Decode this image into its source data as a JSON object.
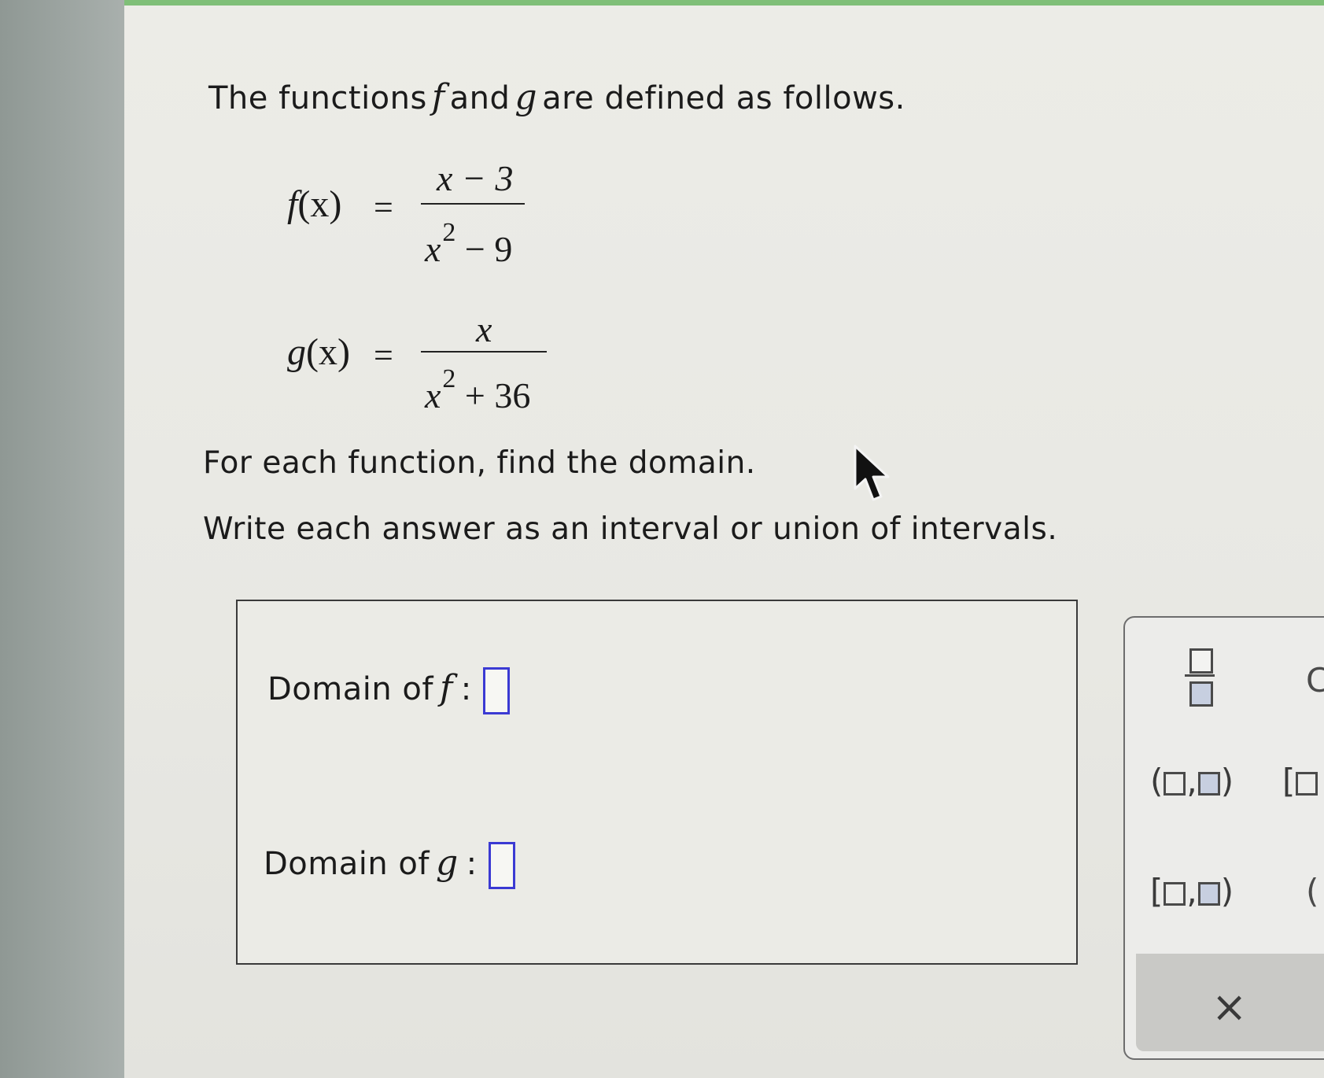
{
  "question": {
    "intro_before": "The functions",
    "f_symbol": "f",
    "and_word": "and",
    "g_symbol": "g",
    "intro_after": "are defined as follows.",
    "f_def": {
      "lhs_name": "f",
      "lhs_arg": "(x)",
      "equals": "=",
      "numerator": "x − 3",
      "den_base": "x",
      "den_exp": "2",
      "den_rest": "− 9"
    },
    "g_def": {
      "lhs_name": "g",
      "lhs_arg": "(x)",
      "equals": "=",
      "numerator": "x",
      "den_base": "x",
      "den_exp": "2",
      "den_rest": "+ 36"
    },
    "instruction_1": "For each function, find the domain.",
    "instruction_2": "Write each answer as an interval or union of intervals."
  },
  "answers": {
    "domain_f_label": "Domain of",
    "f_symbol": "f",
    "colon": ":",
    "domain_f_value": "",
    "domain_g_label": "Domain of",
    "g_symbol": "g",
    "domain_g_value": ""
  },
  "palette": {
    "open_open": {
      "left": "(",
      "comma": ",",
      "right": ")"
    },
    "closed_open": {
      "left": "[",
      "comma": ",",
      "right": ")"
    },
    "partial_bracket": "[",
    "partial_right_top": "C",
    "partial_right_bottom": "(",
    "clear_label": "×"
  },
  "colors": {
    "accent_top": "#7fbf78",
    "input_border": "#3b3ad3"
  },
  "icons": [
    "fraction-icon",
    "open-interval-icon",
    "closed-open-interval-icon",
    "close-icon",
    "mouse-cursor-icon"
  ]
}
